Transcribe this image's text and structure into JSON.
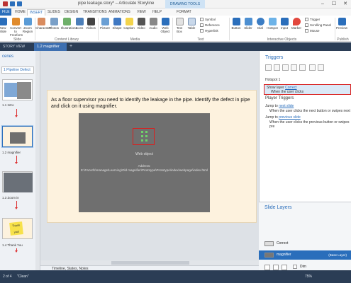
{
  "titlebar": {
    "title": "pipe leakage.story* – Articulate Storyline",
    "context_tab": "DRAWING TOOLS",
    "minimize": "–",
    "maximize": "☐",
    "close": "✕"
  },
  "tabs": [
    "FILE",
    "HOME",
    "INSERT",
    "SLIDES",
    "DESIGN",
    "TRANSITIONS",
    "ANIMATIONS",
    "VIEW",
    "HELP",
    "FORMAT"
  ],
  "active_tab": "INSERT",
  "ribbon": {
    "slide_buttons": [
      "New Slide",
      "Convert to Freeform",
      "Zoom Region"
    ],
    "content_library": [
      "Characters",
      "Photos",
      "Illustrations",
      "Icons",
      "Videos"
    ],
    "media": [
      "Picture",
      "Shape",
      "Caption",
      "Video",
      "Audio",
      "Web Object"
    ],
    "text": [
      "Text Box",
      "Table"
    ],
    "text_options": [
      "Symbol",
      "Reference",
      "Hyperlink"
    ],
    "interactive": [
      "Button",
      "Slider",
      "Dial",
      "Hotspot",
      "Input",
      "Marker"
    ],
    "interactive_options": [
      "Trigger",
      "Scrolling Panel",
      "Mouse"
    ],
    "publish": [
      "Preview"
    ],
    "groups": [
      "Slide",
      "Content Library",
      "Media",
      "Text",
      "Interactive Objects",
      "Publish"
    ]
  },
  "doc_tabs": {
    "story_view": "STORY VIEW",
    "active": "1.2 magnifier",
    "add": "+"
  },
  "scenes": {
    "header": "cenes",
    "dropdown": "1 Pipeline Defect",
    "thumbs": [
      {
        "label": "1.1 Intro"
      },
      {
        "label": "1.2 magnifier"
      },
      {
        "label": "1.3 Zoom in"
      },
      {
        "label": "1.4 Thank You",
        "sticker": "Thank you!"
      }
    ]
  },
  "slide": {
    "instruction": "As a floor supervisor you need to identify the leakage in the pipe. Identify the defect in pipe and click on it using magnifier.",
    "web_object_title": "Web object",
    "web_object_caption": "Address:\nE:\\Fazorfs\\manage\\Learning\\Old magnifier\\Prototype\\Prototype\\index\\webpage\\index.html"
  },
  "timeline_label": "Timeline, States, Notes",
  "triggers": {
    "title": "Triggers",
    "hotspot": "Hotspot 1",
    "show_layer": "Show layer",
    "layer_name": "Correct",
    "when": "When the user clicks",
    "player_title": "Player Triggers",
    "jump1": "Jump to",
    "next_slide": "next slide",
    "jump1_when": "When the user clicks the next button or swipes next",
    "jump2": "Jump to",
    "prev_slide": "previous slide",
    "jump2_when": "When the user clicks the previous button or swipes pre"
  },
  "layers": {
    "title": "Slide Layers",
    "items": [
      {
        "name": "Correct",
        "active": false
      },
      {
        "name": "magnifier",
        "active": true,
        "base": "(Base Layer)"
      }
    ],
    "dim_label": "Dim"
  },
  "status": {
    "slide_info": "2 of 4",
    "theme": "\"Clean\"",
    "zoom": "75%"
  }
}
